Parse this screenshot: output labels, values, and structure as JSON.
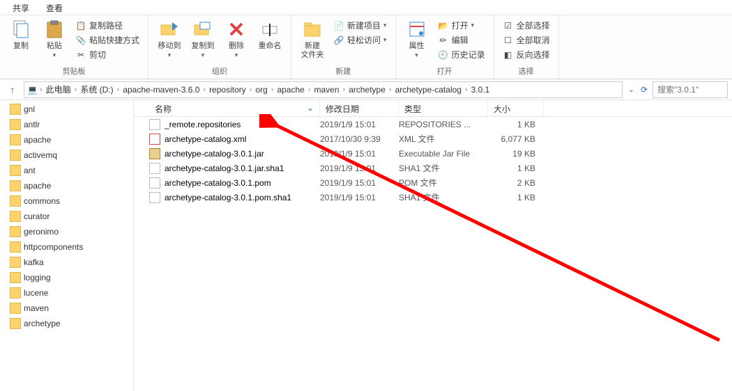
{
  "tabs": {
    "share": "共享",
    "view": "查看"
  },
  "ribbon": {
    "clipboard": {
      "label": "剪贴板",
      "copy": "复制",
      "paste": "粘贴",
      "copy_path": "复制路径",
      "paste_shortcut": "粘贴快捷方式",
      "cut": "剪切"
    },
    "organize": {
      "label": "组织",
      "move_to": "移动到",
      "copy_to": "复制到",
      "delete": "删除",
      "rename": "重命名"
    },
    "new": {
      "label": "新建",
      "new_folder": "新建\n文件夹",
      "new_item": "新建项目",
      "easy_access": "轻松访问"
    },
    "open": {
      "label": "打开",
      "properties": "属性",
      "open": "打开",
      "edit": "编辑",
      "history": "历史记录"
    },
    "select": {
      "label": "选择",
      "select_all": "全部选择",
      "select_none": "全部取消",
      "invert": "反向选择"
    }
  },
  "breadcrumb": {
    "items": [
      "此电脑",
      "系统 (D:)",
      "apache-maven-3.6.0",
      "repository",
      "org",
      "apache",
      "maven",
      "archetype",
      "archetype-catalog",
      "3.0.1"
    ]
  },
  "search": {
    "placeholder": "搜索\"3.0.1\""
  },
  "sidebar": {
    "items": [
      "gnl",
      "antlr",
      "apache",
      "activemq",
      "ant",
      "apache",
      "commons",
      "curator",
      "geronimo",
      "httpcomponents",
      "kafka",
      "logging",
      "lucene",
      "maven",
      "archetype"
    ]
  },
  "columns": {
    "name": "名称",
    "date": "修改日期",
    "type": "类型",
    "size": "大小"
  },
  "files": [
    {
      "name": "_remote.repositories",
      "date": "2019/1/9 15:01",
      "type": "REPOSITORIES ...",
      "size": "1 KB",
      "icon": "file"
    },
    {
      "name": "archetype-catalog.xml",
      "date": "2017/10/30 9:39",
      "type": "XML 文件",
      "size": "6,077 KB",
      "icon": "xml"
    },
    {
      "name": "archetype-catalog-3.0.1.jar",
      "date": "2019/1/9 15:01",
      "type": "Executable Jar File",
      "size": "19 KB",
      "icon": "jar"
    },
    {
      "name": "archetype-catalog-3.0.1.jar.sha1",
      "date": "2019/1/9 15:01",
      "type": "SHA1 文件",
      "size": "1 KB",
      "icon": "file"
    },
    {
      "name": "archetype-catalog-3.0.1.pom",
      "date": "2019/1/9 15:01",
      "type": "POM 文件",
      "size": "2 KB",
      "icon": "file"
    },
    {
      "name": "archetype-catalog-3.0.1.pom.sha1",
      "date": "2019/1/9 15:01",
      "type": "SHA1 文件",
      "size": "1 KB",
      "icon": "file"
    }
  ]
}
